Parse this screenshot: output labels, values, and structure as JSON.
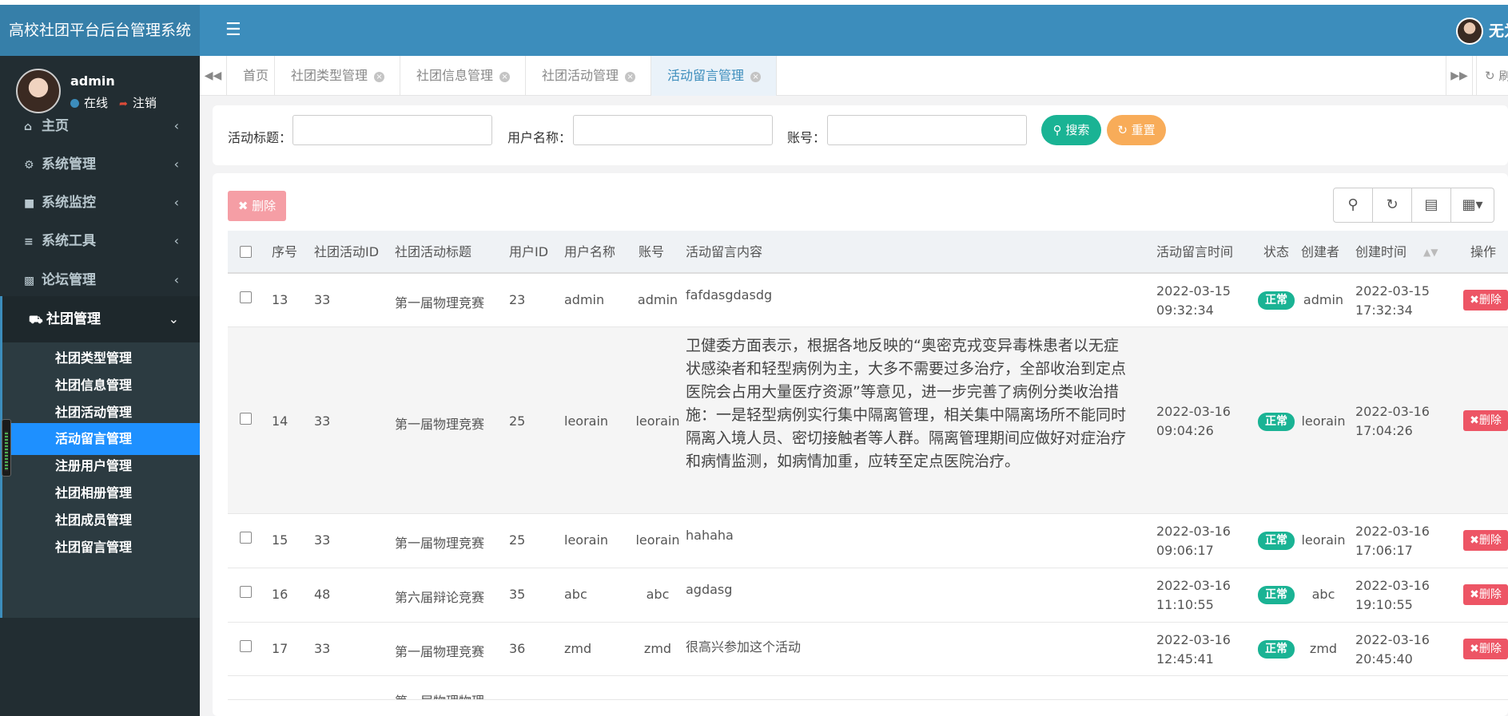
{
  "app": {
    "title": "高校社团平台后台管理系统",
    "header_user": "无为"
  },
  "icons": {
    "menu_toggle": "hamburger-icon",
    "home": "home-icon",
    "settings": "gear-icon",
    "monitor": "video-camera-icon",
    "tools": "bars-icon",
    "forum": "id-card-icon",
    "club": "car-icon",
    "search": "search-icon",
    "refresh": "refresh-icon",
    "columns": "columns-icon",
    "grid": "grid-icon"
  },
  "colors": {
    "header": "#3c8dbc",
    "sidebar": "#222d32",
    "active_sub": "#1e90ff",
    "success": "#1ab394",
    "warning": "#f8ac59",
    "danger": "#ed5565"
  },
  "sidebar": {
    "user": {
      "name": "admin",
      "status": "在线",
      "logout": "注销"
    },
    "menu": [
      {
        "label": "主页",
        "icon": "home-icon"
      },
      {
        "label": "系统管理",
        "icon": "gear-icon"
      },
      {
        "label": "系统监控",
        "icon": "video-camera-icon"
      },
      {
        "label": "系统工具",
        "icon": "bars-icon"
      },
      {
        "label": "论坛管理",
        "icon": "id-card-icon"
      },
      {
        "label": "社团管理",
        "icon": "car-icon"
      }
    ],
    "submenu": [
      "社团类型管理",
      "社团信息管理",
      "社团活动管理",
      "活动留言管理",
      "注册用户管理",
      "社团相册管理",
      "社团成员管理",
      "社团留言管理"
    ]
  },
  "tabs": [
    {
      "label": "首页"
    },
    {
      "label": "社团类型管理"
    },
    {
      "label": "社团信息管理"
    },
    {
      "label": "社团活动管理"
    },
    {
      "label": "活动留言管理"
    }
  ],
  "tab_refresh": "刷新",
  "search": {
    "activity_title_label": "活动标题：",
    "username_label": "用户名称：",
    "account_label": "账号：",
    "search_btn": "搜索",
    "reset_btn": "重置"
  },
  "toolbar": {
    "delete_btn": "删除"
  },
  "table": {
    "headers": [
      "序号",
      "社团活动ID",
      "社团活动标题",
      "用户ID",
      "用户名称",
      "账号",
      "活动留言内容",
      "活动留言时间",
      "状态",
      "创建者",
      "创建时间",
      "操作"
    ],
    "delete_label": "删除",
    "rows": [
      {
        "id": "13",
        "activity_id": "33",
        "activity_title": "第一届物理竞赛",
        "user_id": "23",
        "username": "admin",
        "account": "admin",
        "content": "fafdasgdasdg",
        "msg_date": "2022-03-15",
        "msg_time": "09:32:34",
        "status": "正常",
        "creator": "admin",
        "created_date": "2022-03-15",
        "created_time": "17:32:34"
      },
      {
        "id": "14",
        "activity_id": "33",
        "activity_title": "第一届物理竞赛",
        "user_id": "25",
        "username": "leorain",
        "account": "leorain",
        "content": "卫健委方面表示，根据各地反映的“奥密克戎变异毒株患者以无症状感染者和轻型病例为主，大多不需要过多治疗，全部收治到定点医院会占用大量医疗资源”等意见，进一步完善了病例分类收治措施：一是轻型病例实行集中隔离管理，相关集中隔离场所不能同时隔离入境人员、密切接触者等人群。隔离管理期间应做好对症治疗和病情监测，如病情加重，应转至定点医院治疗。",
        "msg_date": "2022-03-16",
        "msg_time": "09:04:26",
        "status": "正常",
        "creator": "leorain",
        "created_date": "2022-03-16",
        "created_time": "17:04:26"
      },
      {
        "id": "15",
        "activity_id": "33",
        "activity_title": "第一届物理竞赛",
        "user_id": "25",
        "username": "leorain",
        "account": "leorain",
        "content": "hahaha",
        "msg_date": "2022-03-16",
        "msg_time": "09:06:17",
        "status": "正常",
        "creator": "leorain",
        "created_date": "2022-03-16",
        "created_time": "17:06:17"
      },
      {
        "id": "16",
        "activity_id": "48",
        "activity_title": "第六届辩论竞赛",
        "user_id": "35",
        "username": "abc",
        "account": "abc",
        "content": "agdasg",
        "msg_date": "2022-03-16",
        "msg_time": "11:10:55",
        "status": "正常",
        "creator": "abc",
        "created_date": "2022-03-16",
        "created_time": "19:10:55"
      },
      {
        "id": "17",
        "activity_id": "33",
        "activity_title": "第一届物理竞赛",
        "user_id": "36",
        "username": "zmd",
        "account": "zmd",
        "content": "很高兴参加这个活动",
        "msg_date": "2022-03-16",
        "msg_time": "12:45:41",
        "status": "正常",
        "creator": "zmd",
        "created_date": "2022-03-16",
        "created_time": "20:45:40"
      }
    ],
    "partial_row_title": "第一届物理物理"
  }
}
